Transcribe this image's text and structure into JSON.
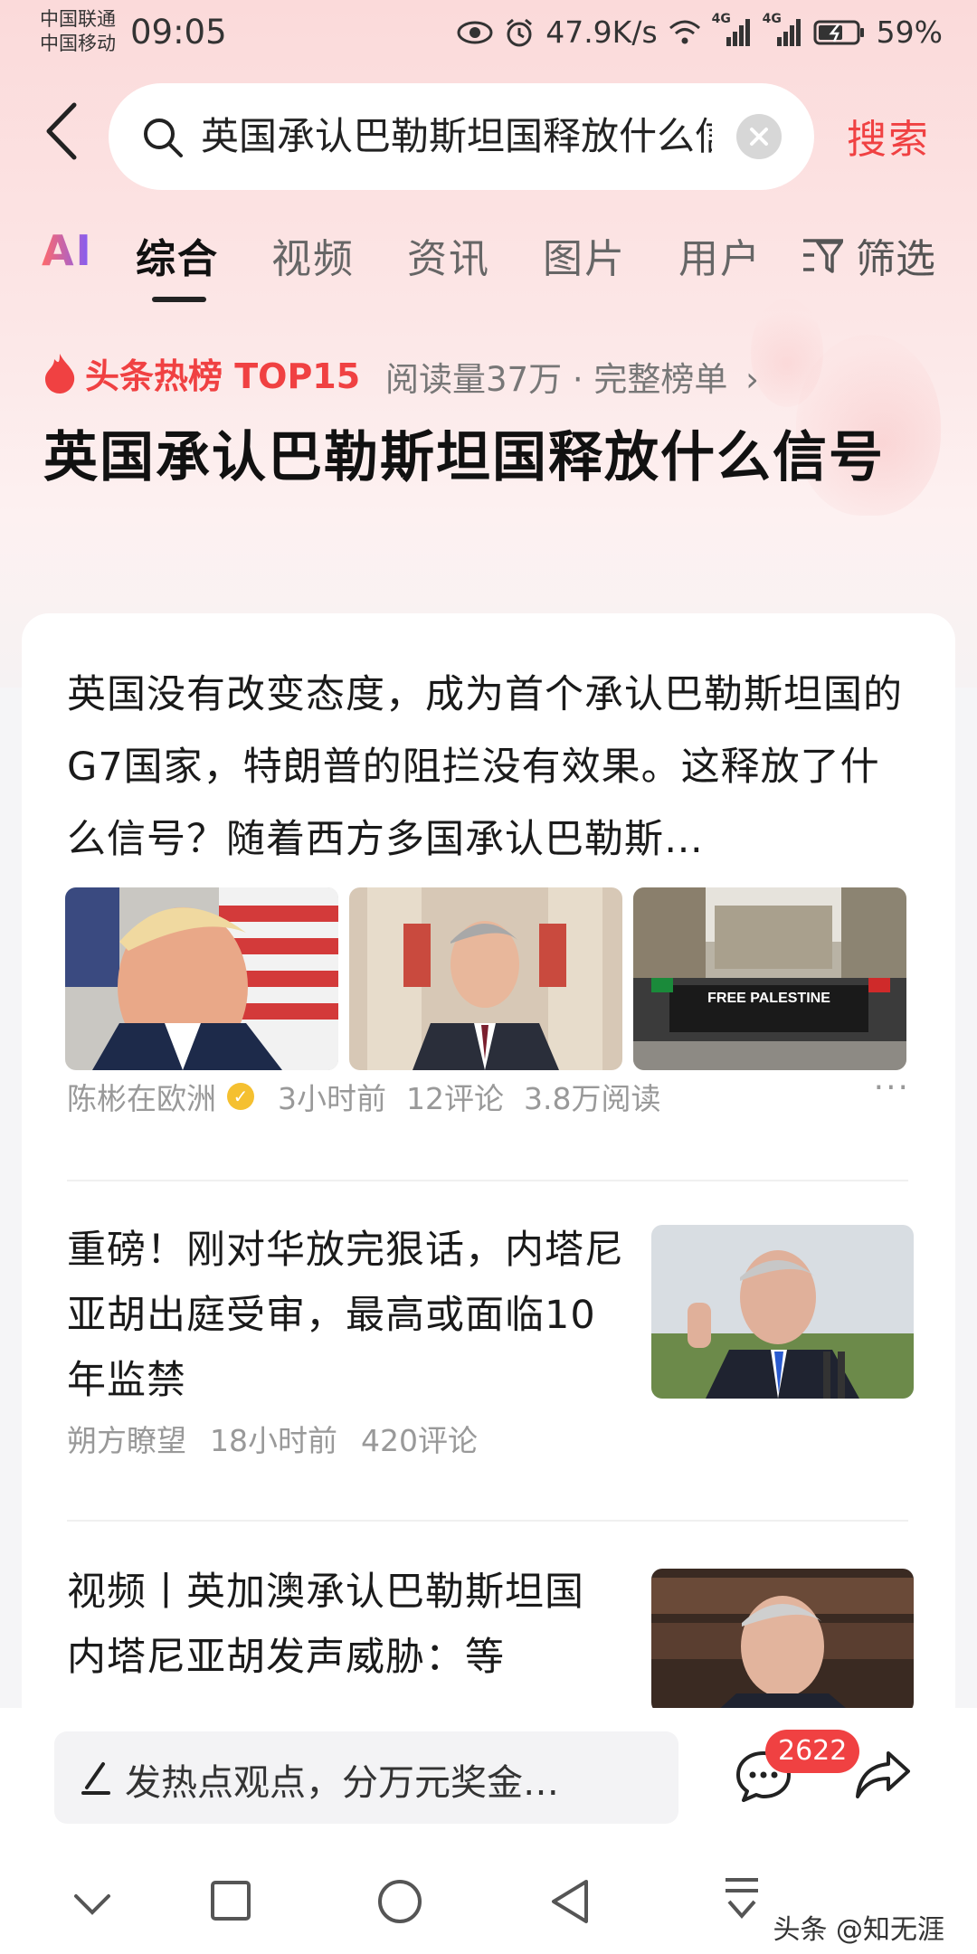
{
  "status_bar": {
    "carrier_1": "中国联通",
    "carrier_2": "中国移动",
    "time": "09:05",
    "net_speed": "47.9K/s",
    "signal_1_label": "4G",
    "signal_2_label": "4G",
    "battery": "59%"
  },
  "search": {
    "query": "英国承认巴勒斯坦国释放什么信号",
    "submit_label": "搜索"
  },
  "tabs": {
    "ai": "AI",
    "items": [
      "综合",
      "视频",
      "资讯",
      "图片",
      "用户"
    ],
    "active": "综合",
    "filter": "筛选"
  },
  "hotlist": {
    "label": "头条热榜 TOP15",
    "meta": "阅读量37万 · 完整榜单",
    "headline": "英国承认巴勒斯坦国释放什么信号"
  },
  "articles": [
    {
      "text": "英国没有改变态度，成为首个承认巴勒斯坦国的G7国家，特朗普的阻拦没有效果。这释放了什么信号？随着西方多国承认巴勒斯…",
      "banner_text": "FREE PALESTINE",
      "author": "陈彬在欧洲",
      "time": "3小时前",
      "comments": "12评论",
      "reads": "3.8万阅读"
    },
    {
      "text": "重磅！刚对华放完狠话，内塔尼亚胡出庭受审，最高或面临10年监禁",
      "author": "朔方瞭望",
      "time": "18小时前",
      "comments": "420评论"
    },
    {
      "text": "视频丨英加澳承认巴勒斯坦国 内塔尼亚胡发声威胁：等"
    }
  ],
  "bottom": {
    "comment_placeholder": "发热点观点，分万元奖金…",
    "comment_count": "2622",
    "watermark": "头条 @知无涯"
  },
  "colors": {
    "accent": "#f04142",
    "bg": "#f5f5f7"
  },
  "icons": [
    "back-arrow-icon",
    "search-icon",
    "clear-icon",
    "filter-icon",
    "flame-icon",
    "verified-icon",
    "more-icon",
    "pen-icon",
    "comment-icon",
    "share-icon",
    "nav-down-icon",
    "nav-square-icon",
    "nav-circle-icon",
    "nav-back-icon",
    "nav-menu-icon"
  ]
}
